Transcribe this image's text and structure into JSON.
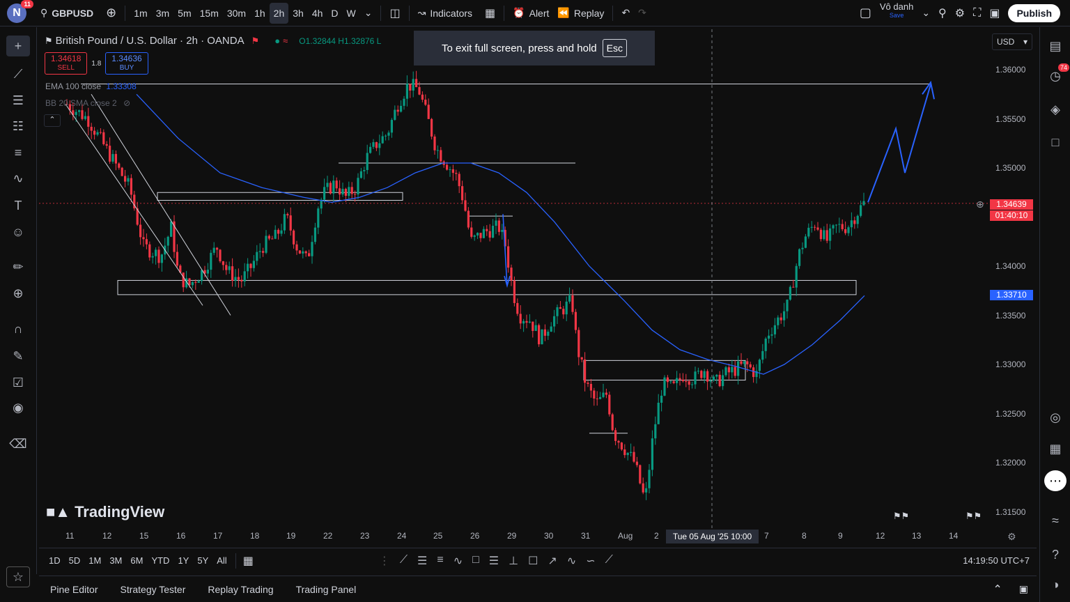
{
  "topbar": {
    "user_initial": "N",
    "notif_count": "11",
    "symbol": "GBPUSD",
    "intervals": [
      "1m",
      "3m",
      "5m",
      "15m",
      "30m",
      "1h",
      "2h",
      "3h",
      "4h",
      "D",
      "W"
    ],
    "active_interval": "2h",
    "indicators_label": "Indicators",
    "alert_label": "Alert",
    "replay_label": "Replay",
    "layout_name": "Vô danh",
    "save_label": "Save",
    "publish_label": "Publish"
  },
  "legend": {
    "title": "British Pound / U.S. Dollar · 2h · OANDA",
    "ohlc": "O1.32844 H1.32876 L",
    "sell_price": "1.34618",
    "sell_label": "SELL",
    "spread": "1.8",
    "buy_price": "1.34636",
    "buy_label": "BUY",
    "ema_label": "EMA 100 close",
    "ema_value": "1.33308",
    "bb_label": "BB 20 SMA close 2"
  },
  "fullscreen": {
    "message": "To exit full screen, press and hold",
    "key": "Esc"
  },
  "currency": "USD",
  "price_axis": [
    "1.36000",
    "1.35500",
    "1.35000",
    "1.34500",
    "1.34000",
    "1.33500",
    "1.33000",
    "1.32500",
    "1.32000",
    "1.31500"
  ],
  "price_tags": {
    "last": "1.34639",
    "countdown": "01:40:10",
    "ema": "1.33710"
  },
  "time_axis": [
    "11",
    "12",
    "15",
    "16",
    "17",
    "18",
    "19",
    "22",
    "23",
    "24",
    "25",
    "26",
    "29",
    "30",
    "31",
    "Aug",
    "2",
    "7",
    "8",
    "9",
    "12",
    "13",
    "14"
  ],
  "crosshair_label": "Tue 05 Aug '25   10:00",
  "watermark": "TradingView",
  "ranges": [
    "1D",
    "5D",
    "1M",
    "3M",
    "6M",
    "YTD",
    "1Y",
    "5Y",
    "All"
  ],
  "clock": "14:19:50 UTC+7",
  "panels": [
    "Pine Editor",
    "Strategy Tester",
    "Replay Trading",
    "Trading Panel"
  ],
  "right_badge": "74",
  "colors": {
    "up": "#089981",
    "down": "#f23645",
    "ema": "#2962ff",
    "bg": "#0f0f0f"
  }
}
